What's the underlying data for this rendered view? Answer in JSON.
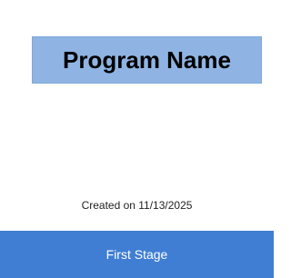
{
  "card": {
    "title": "Program Name",
    "created": "Created on 11/13/2025",
    "stage_label": "First Stage"
  },
  "colors": {
    "title_banner": "#8fb4e3",
    "stage_bar": "#3f7ed3",
    "stage_text": "#ffffff"
  }
}
